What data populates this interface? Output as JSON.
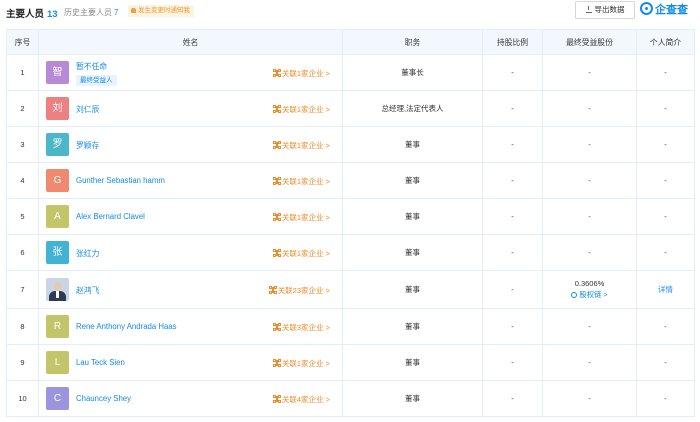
{
  "header": {
    "title": "主要人员",
    "count": "13",
    "history_label": "历史主要人员",
    "history_count": "7",
    "notice": "发生变更时通知我",
    "export_label": "导出数据",
    "brand": "企查查"
  },
  "table": {
    "columns": [
      "序号",
      "姓名",
      "职务",
      "持股比例",
      "最终受益股份",
      "个人简介"
    ],
    "rows": [
      {
        "index": "1",
        "avatar_char": "智",
        "avatar_color": "#b78ad8",
        "name": "暂不任命",
        "tag": "最终受益人",
        "related": "关联1家企业 >",
        "position": "董事长",
        "ratio": "-",
        "benefit": "-",
        "profile": "-"
      },
      {
        "index": "2",
        "avatar_char": "刘",
        "avatar_color": "#ed8080",
        "name": "刘仁辰",
        "tag": "",
        "related": "关联1家企业 >",
        "position": "总经理,法定代表人",
        "ratio": "-",
        "benefit": "-",
        "profile": "-"
      },
      {
        "index": "3",
        "avatar_char": "罗",
        "avatar_color": "#4bb7c9",
        "name": "罗颖存",
        "tag": "",
        "related": "关联1家企业 >",
        "position": "董事",
        "ratio": "-",
        "benefit": "-",
        "profile": "-"
      },
      {
        "index": "4",
        "avatar_char": "G",
        "avatar_color": "#ef8a70",
        "name": "Gunther Sebastian hamm",
        "tag": "",
        "related": "关联1家企业 >",
        "position": "董事",
        "ratio": "-",
        "benefit": "-",
        "profile": "-"
      },
      {
        "index": "5",
        "avatar_char": "A",
        "avatar_color": "#c3c56a",
        "name": "Alex Bernard Clavel",
        "tag": "",
        "related": "关联1家企业 >",
        "position": "董事",
        "ratio": "-",
        "benefit": "-",
        "profile": "-"
      },
      {
        "index": "6",
        "avatar_char": "张",
        "avatar_color": "#42b3d4",
        "name": "张红力",
        "tag": "",
        "related": "关联1家企业 >",
        "position": "董事",
        "ratio": "-",
        "benefit": "-",
        "profile": "-"
      },
      {
        "index": "7",
        "avatar_char": "",
        "avatar_color": "",
        "name": "赵鸿飞",
        "tag": "",
        "related": "关联23家企业 >",
        "position": "董事",
        "ratio": "-",
        "benefit": "0.3606%",
        "benefit_link": "股权链 >",
        "profile": "详情"
      },
      {
        "index": "8",
        "avatar_char": "R",
        "avatar_color": "#c3c56a",
        "name": "Rene Anthony Andrada Haas",
        "tag": "",
        "related": "关联3家企业 >",
        "position": "董事",
        "ratio": "-",
        "benefit": "-",
        "profile": "-"
      },
      {
        "index": "9",
        "avatar_char": "L",
        "avatar_color": "#c3c56a",
        "name": "Lau Teck Sien",
        "tag": "",
        "related": "关联1家企业 >",
        "position": "董事",
        "ratio": "-",
        "benefit": "-",
        "profile": "-"
      },
      {
        "index": "10",
        "avatar_char": "C",
        "avatar_color": "#9b95e0",
        "name": "Chauncey Shey",
        "tag": "",
        "related": "关联4家企业 >",
        "position": "董事",
        "ratio": "-",
        "benefit": "-",
        "profile": "-"
      }
    ]
  }
}
